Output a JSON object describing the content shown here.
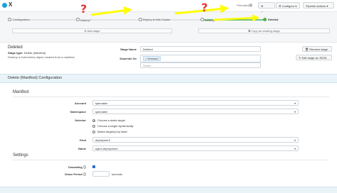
{
  "header": {
    "title": "X",
    "permalink": "Permalink",
    "create_label": "Create",
    "configure_label": "Configure",
    "actions_label": "Pipeline Actions"
  },
  "graph": {
    "nodes": [
      {
        "label": "Configuration"
      },
      {
        "label": "Deploy?"
      },
      {
        "label": "Deploy to K8s Cluster"
      },
      {
        "label": "Destroy?"
      },
      {
        "label": "Deleted"
      }
    ],
    "add_stage": "Add stage",
    "copy_stage": "Copy an existing stage",
    "annotation_mark": "?"
  },
  "stage": {
    "heading": "Deleted",
    "type_label": "Stage type:",
    "type_value": "Delete (Manifest)",
    "description": "Destroy a Kubernetes object created from a manifest.",
    "stage_name_label": "Stage Name",
    "stage_name_value": "Deleted",
    "depends_on_label": "Depends On",
    "depends_on_tag": "Destroy?",
    "depends_on_placeholder": "Select...",
    "remove_label": "Remove stage",
    "edit_json_label": "Edit stage as JSON"
  },
  "config": {
    "title": "Delete (Manifest) Configuration",
    "manifest_heading": "Manifest",
    "account_label": "Account",
    "account_value": "spinnaker",
    "namespace_label": "Namespace",
    "namespace_value": "spinnaker",
    "selector_label": "Selector",
    "selector_options": [
      "Choose a static target",
      "Choose a target dynamically",
      "Match target(s) by label"
    ],
    "kind_label": "Kind",
    "kind_value": "deployment",
    "name_label": "Name",
    "name_value": "nginx-deployment",
    "settings_heading": "Settings",
    "cascading_label": "Cascading",
    "grace_label": "Grace Period",
    "grace_unit": "seconds"
  },
  "colors": {
    "accent": "#1aa2d7",
    "success": "#4caf50",
    "annotation_arrow": "#ffff00",
    "annotation_mark": "#e53935"
  }
}
